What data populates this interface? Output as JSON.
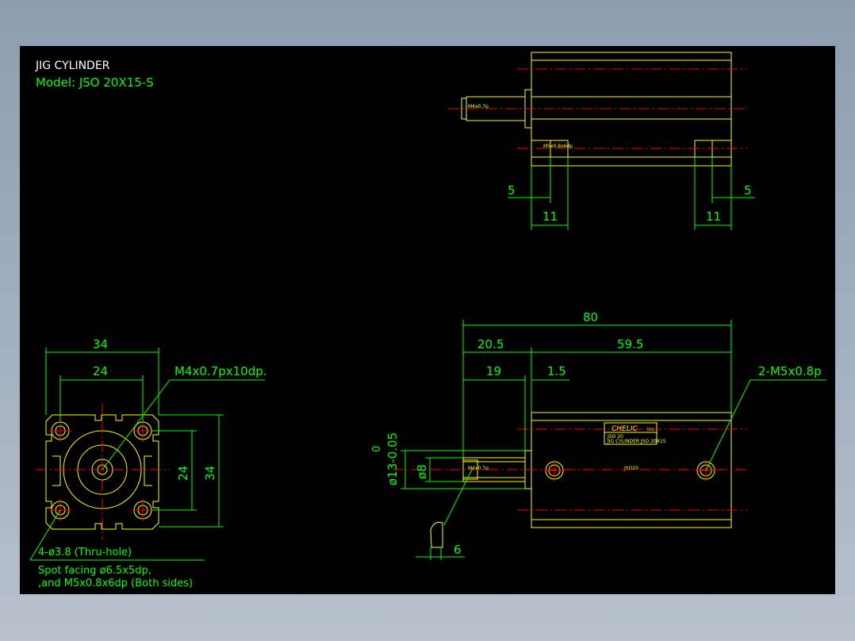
{
  "title": "JIG CYLINDER",
  "model": "Model: JSO 20X15-S",
  "colors": {
    "background": "#000000",
    "outline": "#ffff00",
    "centerline": "#ff0000",
    "dimension": "#00ff00",
    "title": "#ffffff"
  },
  "top_view": {
    "port_label": "M4x0.7p",
    "mount_label": "M5x0.8x6dp",
    "dims": {
      "left_small": "5",
      "right_small": "5",
      "left_len": "11",
      "right_len": "11"
    }
  },
  "end_view": {
    "overall_width": "34",
    "hole_spacing_w": "24",
    "hole_spacing_h": "24",
    "overall_height": "34",
    "thread_callout": "M4x0.7px10dp.",
    "hole_note_1": "4-ø3.8 (Thru-hole)",
    "hole_note_2": "Spot facing ø6.5x5dp,",
    "hole_note_3": ",and M5x0.8x6dp (Both sides)"
  },
  "side_view": {
    "overall_length": "80",
    "rod_section": "20.5",
    "body_length": "59.5",
    "rod_extension": "19",
    "collar": "1.5",
    "mount_callout": "2-M5x0.8p",
    "rod_diameter": "ø13-0.05",
    "rod_tol_upper": "0",
    "bore_diameter": "ø8",
    "wrench_flat": "6",
    "rod_label": "M4x0.7p",
    "brand": "CHELIC",
    "brand_suffix": "inc",
    "plate_line1": "JSO 20",
    "plate_line2": "JIG CYLINDER JSO 20X15",
    "body_mark": "JSO20"
  }
}
